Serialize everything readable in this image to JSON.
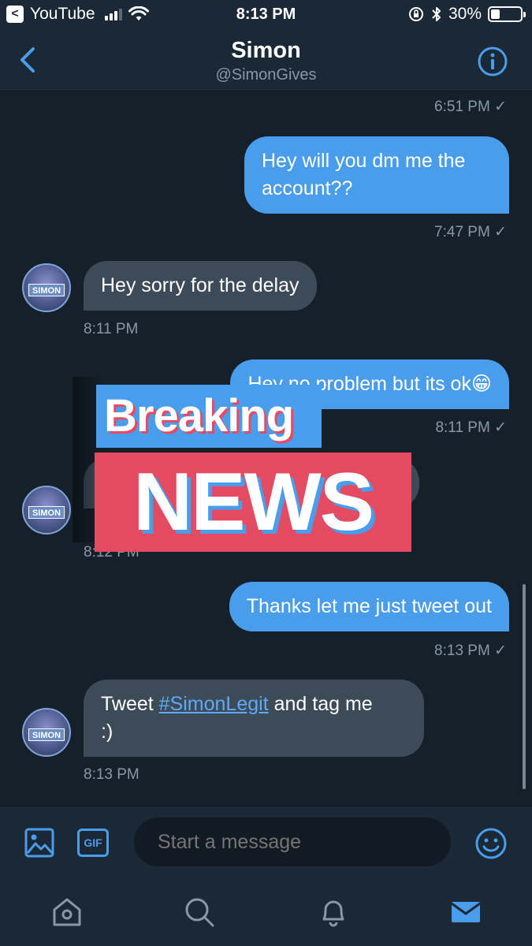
{
  "status_bar": {
    "app_back_label": "YouTube",
    "time": "8:13 PM",
    "battery_text": "30%",
    "battery_level": 0.3
  },
  "header": {
    "title": "Simon",
    "subtitle": "@SimonGives"
  },
  "avatar_text": "SIMON",
  "messages": [
    {
      "type": "timestamp",
      "side": "sent",
      "time": "6:51 PM ✓"
    },
    {
      "type": "sent",
      "text": "Hey will you dm me the account??",
      "time": "7:47 PM ✓"
    },
    {
      "type": "received",
      "text": "Hey sorry for the delay",
      "time": "8:11 PM"
    },
    {
      "type": "sent",
      "text": "Hey no problem but its ok😁",
      "time": "8:11 PM ✓"
    },
    {
      "type": "received",
      "text": "",
      "time": "8:12 PM"
    },
    {
      "type": "sent",
      "text": "Thanks let me just tweet out",
      "time": "8:13 PM ✓"
    },
    {
      "type": "received",
      "text_before": "Tweet ",
      "hashtag": "#SimonLegit",
      "text_after": " and tag me",
      "text_line2": ":)",
      "time": "8:13 PM"
    }
  ],
  "overlay": {
    "breaking": "Breaking",
    "news": "NEWS"
  },
  "composer": {
    "gif_label": "GIF",
    "placeholder": "Start a message"
  },
  "tabs": [
    "home-icon",
    "search-icon",
    "bell-icon",
    "mail-icon"
  ],
  "colors": {
    "accent": "#4a9deb",
    "background": "#15202b",
    "received_bubble": "#3d4a57",
    "news_red": "#e54a63"
  }
}
